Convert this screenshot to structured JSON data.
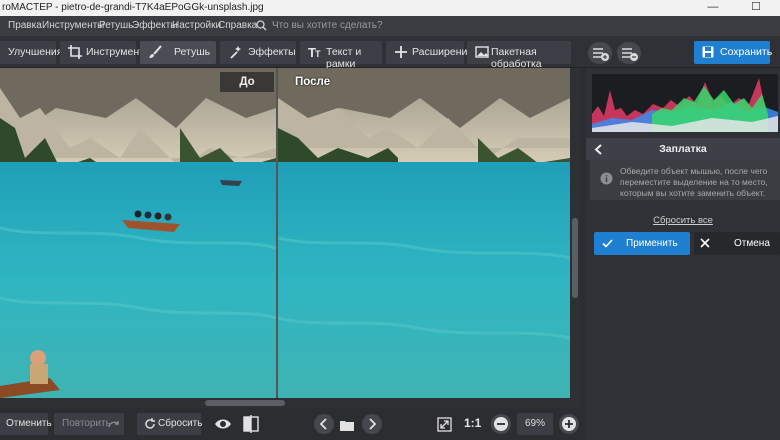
{
  "window": {
    "title": "roMACTEP - pietro-de-grandi-T7K4aEPoGGk-unsplash.jpg",
    "minimize": "—",
    "maximize": "☐"
  },
  "menu": [
    "Правка",
    "Инструменты",
    "Ретушь",
    "Эффекты",
    "Настройки",
    "Справка"
  ],
  "search": {
    "placeholder": "Что вы хотите сделать?"
  },
  "toolbar": {
    "tabs": [
      "Улучшения",
      "Инструменты",
      "Ретушь",
      "Эффекты",
      "Текст и рамки",
      "Расширения",
      "Пакетная обработка"
    ],
    "active_tab": "Ретушь",
    "save_label": "Сохранить"
  },
  "viewer": {
    "before_label": "До",
    "after_label": "После"
  },
  "bottom": {
    "undo_label": "Отменить",
    "redo_label": "Повторить",
    "reset_label": "Сбросить",
    "fit_label": "1:1",
    "zoom_value": "69%"
  },
  "panel": {
    "title": "Заплатка",
    "hint": "Обведите объект мышью, после чего переместите выделение на то место, которым вы хотите заменить объект.",
    "reset_all": "Сбросить все",
    "apply_label": "Применить",
    "cancel_label": "Отмена"
  },
  "colors": {
    "accent": "#1f7fd0",
    "panel_bg": "#2f3136",
    "toolbar_bg": "#2f3136"
  }
}
